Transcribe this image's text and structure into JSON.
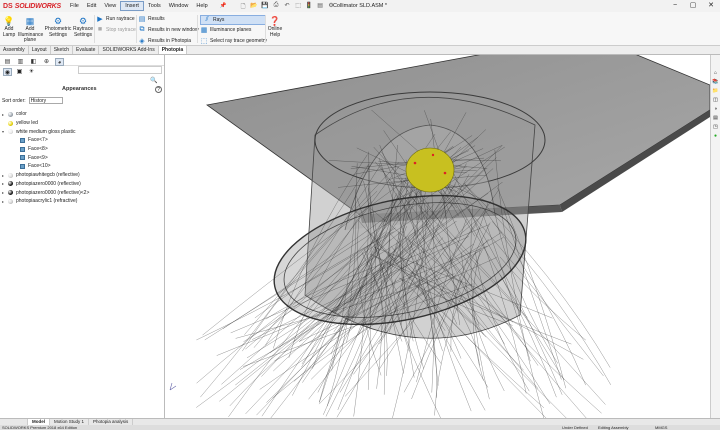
{
  "app": {
    "logo_brand": "DS",
    "logo_text": "SOLIDWORKS",
    "document_title": "Collimator SLD.ASM *",
    "menu": [
      "File",
      "Edit",
      "View",
      "Insert",
      "Tools",
      "Window",
      "Help"
    ],
    "active_menu": "Insert",
    "window_controls": [
      "−",
      "▢",
      "✕"
    ]
  },
  "ribbon": {
    "add_lamp": "Add Lamp",
    "add_illuminance_plane": "Add Illuminance plane",
    "photometric_settings": "Photometric Settings",
    "raytrace_settings": "Raytrace Settings",
    "run_raytrace": "Run raytrace",
    "stop_raytrace": "Stop raytrace",
    "results": "Results",
    "results_new_window": "Results in new window",
    "results_photopia": "Results in Photopia",
    "rays": "Rays",
    "illuminance_planes": "Illuminance planes",
    "select_ray_trace_geometry": "Select ray trace geometry",
    "online_help": "Online Help"
  },
  "tabs": [
    "Assembly",
    "Layout",
    "Sketch",
    "Evaluate",
    "SOLIDWORKS Add-Ins",
    "Photopia"
  ],
  "active_tab": "Photopia",
  "panel": {
    "title": "Appearances",
    "help": "?",
    "sort_label": "Sort order:",
    "sort_value": "History",
    "items": [
      {
        "label": "color",
        "color": "#9aa3ad",
        "kind": "ball",
        "expand": "▸"
      },
      {
        "label": "yellow led",
        "color": "#e8d400",
        "kind": "ball",
        "expand": ""
      },
      {
        "label": "white medium gloss plastic",
        "color": "#e9e9e9",
        "kind": "ball",
        "expand": "▾"
      },
      {
        "label": "Face<7>",
        "kind": "face",
        "child": true
      },
      {
        "label": "Face<8>",
        "kind": "face",
        "child": true
      },
      {
        "label": "Face<9>",
        "kind": "face",
        "child": true
      },
      {
        "label": "Face<10>",
        "kind": "face",
        "child": true
      },
      {
        "label": "photopiawhitegcb (reflective)",
        "color": "#d8d8d8",
        "kind": "ball",
        "expand": "▸"
      },
      {
        "label": "photopiazero0000 (reflective)",
        "color": "#111111",
        "kind": "ball",
        "expand": "▸"
      },
      {
        "label": "photopiazero0000 (reflective)<2>",
        "color": "#111111",
        "kind": "ball",
        "expand": "▸"
      },
      {
        "label": "photopiaacrylic1 (refractive)",
        "color": "#cfcfcf",
        "kind": "ball",
        "expand": "▸"
      }
    ]
  },
  "bottom_tabs": [
    "Model",
    "Motion Study 1",
    "Photopia analysis"
  ],
  "active_bottom_tab": "Model",
  "status": {
    "left": "SOLIDWORKS Premium 2018 x64 Edition",
    "under_defined": "Under Defined",
    "editing": "Editing Assembly",
    "units": "MMGS"
  },
  "colors": {
    "accent": "#1c73c4",
    "brand_red": "#d8232a",
    "led_yellow": "#c8c020",
    "housing": "#7d7d7d"
  }
}
